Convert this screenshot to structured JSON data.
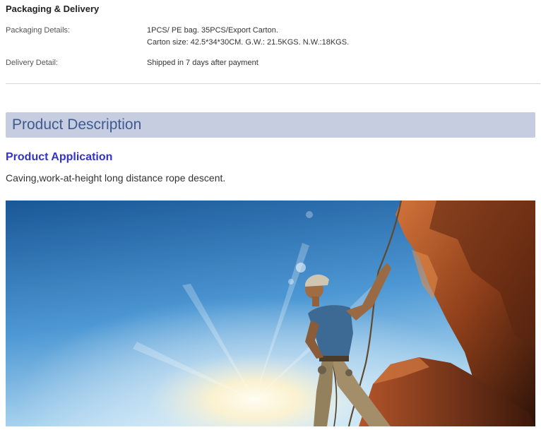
{
  "packaging": {
    "title": "Packaging & Delivery",
    "rows": [
      {
        "label": "Packaging Details:",
        "lines": [
          "1PCS/ PE bag. 35PCS/Export Carton.",
          "Carton size: 42.5*34*30CM. G.W.: 21.5KGS. N.W.:18KGS."
        ]
      },
      {
        "label": "Delivery Detail:",
        "lines": [
          "Shipped in 7 days after payment"
        ]
      }
    ]
  },
  "description": {
    "title": "Product Description"
  },
  "application": {
    "title": "Product Application",
    "text": "Caving,work-at-height long distance rope descent."
  },
  "photo": {
    "subject": "climber-on-rock-cliff",
    "colors": {
      "sky_top": "#1d5fa3",
      "sky_bottom": "#a9d4f0",
      "sun": "#fff6d8",
      "rock_light": "#c0602c",
      "rock_dark": "#3a1a0c",
      "shirt": "#3d6b96"
    }
  }
}
